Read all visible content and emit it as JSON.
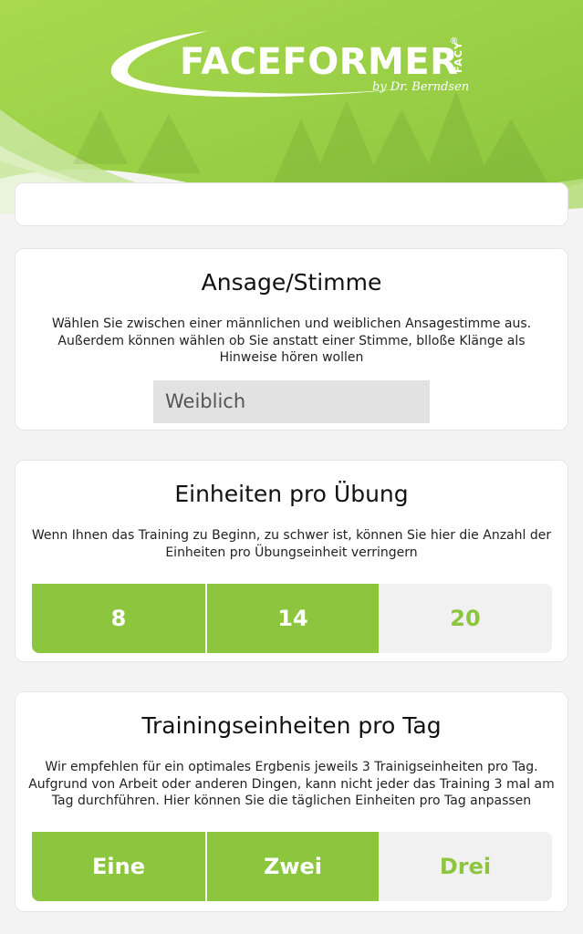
{
  "header": {
    "logo_face": "FACE",
    "logo_former": "FORMER",
    "logo_registered": "®",
    "logo_facy": "FACY",
    "logo_byline": "by Dr. Berndsen"
  },
  "colors": {
    "accent": "#8cc63f",
    "header_green": "#9dd24a",
    "background": "#f4f4f4"
  },
  "voice": {
    "title": "Ansage/Stimme",
    "description": "Wählen Sie zwischen einer männlichen und weiblichen Ansagestimme aus. Außerdem können wählen ob Sie anstatt einer Stimme, blloße Klänge als Hinweise hören wollen",
    "selected": "Weiblich"
  },
  "units": {
    "title": "Einheiten pro Übung",
    "description": "Wenn Ihnen das Training zu Beginn, zu schwer ist, können Sie hier die Anzahl der Einheiten pro Übungseinheit verringern",
    "options": [
      "8",
      "14",
      "20"
    ]
  },
  "daily": {
    "title": "Trainingseinheiten pro Tag",
    "description": "Wir empfehlen für ein optimales Ergbenis jeweils 3 Trainigseinheiten pro Tag. Aufgrund von Arbeit oder anderen Dingen, kann nicht jeder das Training 3 mal am Tag durchführen. Hier können Sie die täglichen Einheiten pro Tag anpassen",
    "options": [
      "Eine",
      "Zwei",
      "Drei"
    ]
  }
}
